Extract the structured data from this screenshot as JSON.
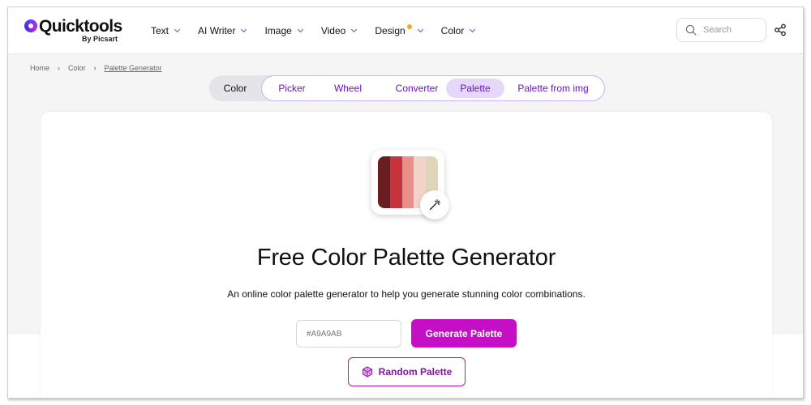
{
  "brand": {
    "name": "Quicktools",
    "sub": "By Picsart"
  },
  "nav": {
    "items": [
      {
        "label": "Text",
        "has_dot": false
      },
      {
        "label": "AI Writer",
        "has_dot": false
      },
      {
        "label": "Image",
        "has_dot": false
      },
      {
        "label": "Video",
        "has_dot": false
      },
      {
        "label": "Design",
        "has_dot": true
      },
      {
        "label": "Color",
        "has_dot": false
      }
    ]
  },
  "search": {
    "placeholder": "Search"
  },
  "breadcrumb": {
    "items": [
      "Home",
      "Color",
      "Palette Generator"
    ]
  },
  "tabs": {
    "category": "Color",
    "items": [
      "Picker",
      "Wheel",
      "Converter",
      "Palette",
      "Palette from img"
    ],
    "active": "Palette"
  },
  "hero": {
    "title": "Free Color Palette Generator",
    "subtitle": "An online color palette generator to help you generate stunning color combinations."
  },
  "palette_swatches": [
    "#6b1e22",
    "#c8343d",
    "#e88f8a",
    "#f2d3c8",
    "#ddd7b8"
  ],
  "form": {
    "hex_placeholder": "#A9A9AB",
    "generate_label": "Generate Palette",
    "random_label": "Random Palette"
  },
  "colors": {
    "accent": "#c40fc4",
    "tab_text": "#6b10c9",
    "tab_active_bg": "#e6d8fb"
  }
}
